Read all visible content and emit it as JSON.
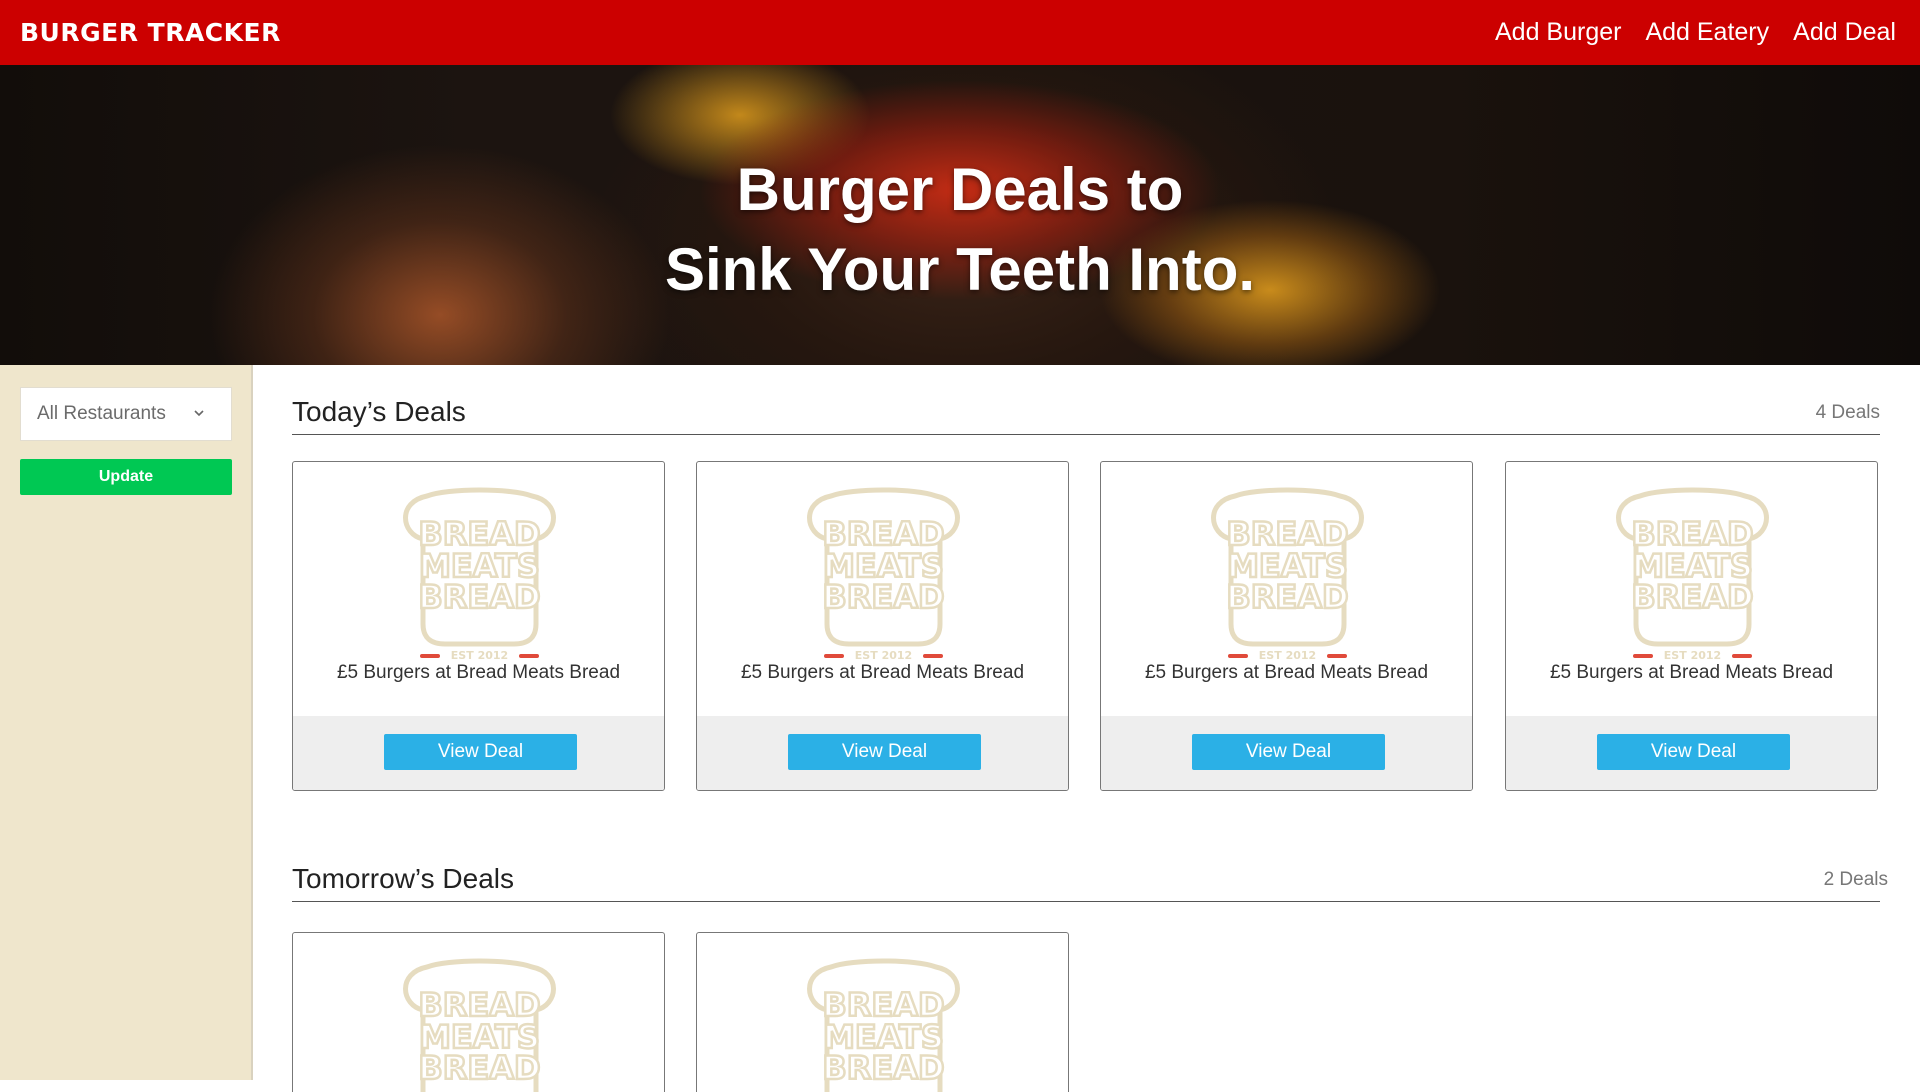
{
  "nav": {
    "brand": "BURGER TRACKER",
    "links": [
      "Add Burger",
      "Add Eatery",
      "Add Deal"
    ]
  },
  "hero": {
    "line1": "Burger Deals to",
    "line2": "Sink Your Teeth Into."
  },
  "sidebar": {
    "restaurant_select": "All Restaurants",
    "update_label": "Update"
  },
  "logo": {
    "line1": "BREAD",
    "line2": "MEATS",
    "line3": "BREAD",
    "est": "EST 2012"
  },
  "today": {
    "title": "Today’s Deals",
    "count": "4 Deals",
    "deals": [
      {
        "title": "£5 Burgers at Bread Meats Bread",
        "button": "View Deal"
      },
      {
        "title": "£5 Burgers at Bread Meats Bread",
        "button": "View Deal"
      },
      {
        "title": "£5 Burgers at Bread Meats Bread",
        "button": "View Deal"
      },
      {
        "title": "£5 Burgers at Bread Meats Bread",
        "button": "View Deal"
      }
    ]
  },
  "tomorrow": {
    "title": "Tomorrow’s Deals",
    "count": "2 Deals"
  },
  "colors": {
    "nav_red": "#cc0000",
    "sidebar_cream": "#efe6cc",
    "update_green": "#00c853",
    "view_blue": "#2bb0e6",
    "logo_tan": "#e6dcc0",
    "logo_red": "#e04a3a"
  }
}
